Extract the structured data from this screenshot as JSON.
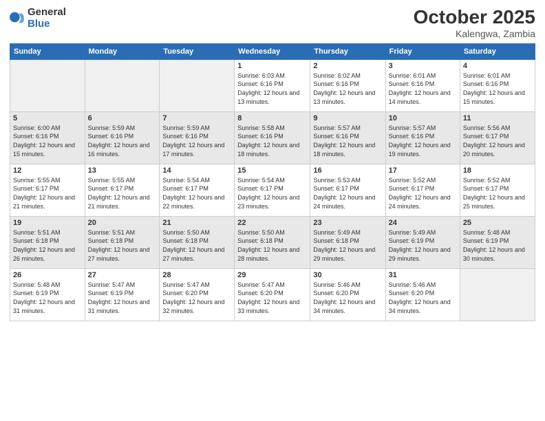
{
  "logo": {
    "general": "General",
    "blue": "Blue"
  },
  "title": {
    "month": "October 2025",
    "location": "Kalengwa, Zambia"
  },
  "weekdays": [
    "Sunday",
    "Monday",
    "Tuesday",
    "Wednesday",
    "Thursday",
    "Friday",
    "Saturday"
  ],
  "weeks": [
    [
      {
        "num": "",
        "info": "",
        "empty": true
      },
      {
        "num": "",
        "info": "",
        "empty": true
      },
      {
        "num": "",
        "info": "",
        "empty": true
      },
      {
        "num": "1",
        "info": "Sunrise: 6:03 AM\nSunset: 6:16 PM\nDaylight: 12 hours\nand 13 minutes.",
        "empty": false
      },
      {
        "num": "2",
        "info": "Sunrise: 6:02 AM\nSunset: 6:16 PM\nDaylight: 12 hours\nand 13 minutes.",
        "empty": false
      },
      {
        "num": "3",
        "info": "Sunrise: 6:01 AM\nSunset: 6:16 PM\nDaylight: 12 hours\nand 14 minutes.",
        "empty": false
      },
      {
        "num": "4",
        "info": "Sunrise: 6:01 AM\nSunset: 6:16 PM\nDaylight: 12 hours\nand 15 minutes.",
        "empty": false
      }
    ],
    [
      {
        "num": "5",
        "info": "Sunrise: 6:00 AM\nSunset: 6:16 PM\nDaylight: 12 hours\nand 15 minutes.",
        "empty": false
      },
      {
        "num": "6",
        "info": "Sunrise: 5:59 AM\nSunset: 6:16 PM\nDaylight: 12 hours\nand 16 minutes.",
        "empty": false
      },
      {
        "num": "7",
        "info": "Sunrise: 5:59 AM\nSunset: 6:16 PM\nDaylight: 12 hours\nand 17 minutes.",
        "empty": false
      },
      {
        "num": "8",
        "info": "Sunrise: 5:58 AM\nSunset: 6:16 PM\nDaylight: 12 hours\nand 18 minutes.",
        "empty": false
      },
      {
        "num": "9",
        "info": "Sunrise: 5:57 AM\nSunset: 6:16 PM\nDaylight: 12 hours\nand 18 minutes.",
        "empty": false
      },
      {
        "num": "10",
        "info": "Sunrise: 5:57 AM\nSunset: 6:16 PM\nDaylight: 12 hours\nand 19 minutes.",
        "empty": false
      },
      {
        "num": "11",
        "info": "Sunrise: 5:56 AM\nSunset: 6:17 PM\nDaylight: 12 hours\nand 20 minutes.",
        "empty": false
      }
    ],
    [
      {
        "num": "12",
        "info": "Sunrise: 5:55 AM\nSunset: 6:17 PM\nDaylight: 12 hours\nand 21 minutes.",
        "empty": false
      },
      {
        "num": "13",
        "info": "Sunrise: 5:55 AM\nSunset: 6:17 PM\nDaylight: 12 hours\nand 21 minutes.",
        "empty": false
      },
      {
        "num": "14",
        "info": "Sunrise: 5:54 AM\nSunset: 6:17 PM\nDaylight: 12 hours\nand 22 minutes.",
        "empty": false
      },
      {
        "num": "15",
        "info": "Sunrise: 5:54 AM\nSunset: 6:17 PM\nDaylight: 12 hours\nand 23 minutes.",
        "empty": false
      },
      {
        "num": "16",
        "info": "Sunrise: 5:53 AM\nSunset: 6:17 PM\nDaylight: 12 hours\nand 24 minutes.",
        "empty": false
      },
      {
        "num": "17",
        "info": "Sunrise: 5:52 AM\nSunset: 6:17 PM\nDaylight: 12 hours\nand 24 minutes.",
        "empty": false
      },
      {
        "num": "18",
        "info": "Sunrise: 5:52 AM\nSunset: 6:17 PM\nDaylight: 12 hours\nand 25 minutes.",
        "empty": false
      }
    ],
    [
      {
        "num": "19",
        "info": "Sunrise: 5:51 AM\nSunset: 6:18 PM\nDaylight: 12 hours\nand 26 minutes.",
        "empty": false
      },
      {
        "num": "20",
        "info": "Sunrise: 5:51 AM\nSunset: 6:18 PM\nDaylight: 12 hours\nand 27 minutes.",
        "empty": false
      },
      {
        "num": "21",
        "info": "Sunrise: 5:50 AM\nSunset: 6:18 PM\nDaylight: 12 hours\nand 27 minutes.",
        "empty": false
      },
      {
        "num": "22",
        "info": "Sunrise: 5:50 AM\nSunset: 6:18 PM\nDaylight: 12 hours\nand 28 minutes.",
        "empty": false
      },
      {
        "num": "23",
        "info": "Sunrise: 5:49 AM\nSunset: 6:18 PM\nDaylight: 12 hours\nand 29 minutes.",
        "empty": false
      },
      {
        "num": "24",
        "info": "Sunrise: 5:49 AM\nSunset: 6:19 PM\nDaylight: 12 hours\nand 29 minutes.",
        "empty": false
      },
      {
        "num": "25",
        "info": "Sunrise: 5:48 AM\nSunset: 6:19 PM\nDaylight: 12 hours\nand 30 minutes.",
        "empty": false
      }
    ],
    [
      {
        "num": "26",
        "info": "Sunrise: 5:48 AM\nSunset: 6:19 PM\nDaylight: 12 hours\nand 31 minutes.",
        "empty": false
      },
      {
        "num": "27",
        "info": "Sunrise: 5:47 AM\nSunset: 6:19 PM\nDaylight: 12 hours\nand 31 minutes.",
        "empty": false
      },
      {
        "num": "28",
        "info": "Sunrise: 5:47 AM\nSunset: 6:20 PM\nDaylight: 12 hours\nand 32 minutes.",
        "empty": false
      },
      {
        "num": "29",
        "info": "Sunrise: 5:47 AM\nSunset: 6:20 PM\nDaylight: 12 hours\nand 33 minutes.",
        "empty": false
      },
      {
        "num": "30",
        "info": "Sunrise: 5:46 AM\nSunset: 6:20 PM\nDaylight: 12 hours\nand 34 minutes.",
        "empty": false
      },
      {
        "num": "31",
        "info": "Sunrise: 5:46 AM\nSunset: 6:20 PM\nDaylight: 12 hours\nand 34 minutes.",
        "empty": false
      },
      {
        "num": "",
        "info": "",
        "empty": true
      }
    ]
  ]
}
